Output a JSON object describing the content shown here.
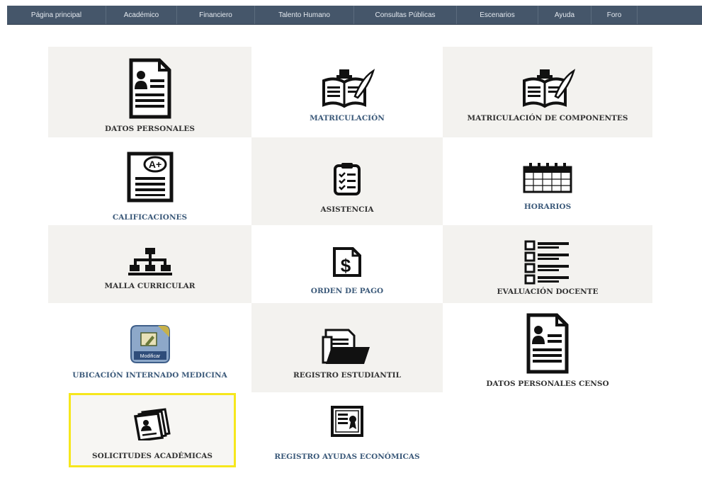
{
  "nav": {
    "items": [
      {
        "label": "Página principal"
      },
      {
        "label": "Académico"
      },
      {
        "label": "Financiero"
      },
      {
        "label": "Talento Humano"
      },
      {
        "label": "Consultas Públicas"
      },
      {
        "label": "Escenarios"
      },
      {
        "label": "Ayuda"
      },
      {
        "label": "Foro"
      }
    ]
  },
  "tiles": {
    "datos_personales": {
      "label": "DATOS PERSONALES"
    },
    "matriculacion": {
      "label": "MATRICULACIÓN"
    },
    "matriculacion_componentes": {
      "label": "MATRICULACIÓN DE COMPONENTES"
    },
    "calificaciones": {
      "label": "CALIFICACIONES",
      "icon_text": "A+"
    },
    "asistencia": {
      "label": "ASISTENCIA"
    },
    "horarios": {
      "label": "HORARIOS"
    },
    "malla_curricular": {
      "label": "MALLA CURRICULAR"
    },
    "orden_pago": {
      "label": "ORDEN DE PAGO",
      "icon_text": "$"
    },
    "evaluacion_docente": {
      "label": "EVALUACIÓN DOCENTE"
    },
    "ubicacion_internado": {
      "label": "UBICACIÓN INTERNADO MEDICINA",
      "icon_text": "Modificar"
    },
    "registro_estudiantil": {
      "label": "REGISTRO ESTUDIANTIL"
    },
    "datos_personales_censo": {
      "label": "DATOS PERSONALES CENSO"
    },
    "solicitudes_academicas": {
      "label": "SOLICITUDES ACADÉMICAS"
    },
    "registro_ayudas": {
      "label": "REGISTRO AYUDAS ECONÓMICAS"
    }
  },
  "colors": {
    "nav_bg": "#45566a",
    "tile_bg": "#f3f2ef",
    "label_blue": "#3c5a7a",
    "label_dark": "#333333",
    "highlight": "#f6e71c"
  },
  "icons": {
    "datos_personales": "document-person-icon",
    "matriculacion": "book-quill-icon",
    "calificaciones": "graded-document-icon",
    "asistencia": "clipboard-checklist-icon",
    "horarios": "calendar-icon",
    "malla_curricular": "org-chart-icon",
    "orden_pago": "dollar-document-icon",
    "evaluacion_docente": "checklist-icon",
    "ubicacion_internado": "edit-app-icon",
    "registro_estudiantil": "folder-documents-icon",
    "solicitudes_academicas": "document-stack-icon",
    "registro_ayudas": "certificate-icon"
  }
}
